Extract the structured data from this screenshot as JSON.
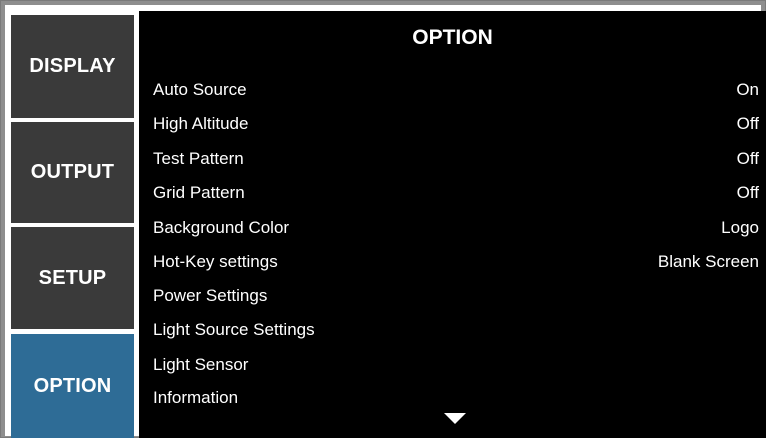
{
  "tabs": [
    {
      "label": "DISPLAY",
      "active": false
    },
    {
      "label": "OUTPUT",
      "active": false
    },
    {
      "label": "SETUP",
      "active": false
    },
    {
      "label": "OPTION",
      "active": true
    }
  ],
  "panel": {
    "title": "OPTION",
    "items": [
      {
        "label": "Auto Source",
        "value": "On"
      },
      {
        "label": "High Altitude",
        "value": "Off"
      },
      {
        "label": "Test Pattern",
        "value": "Off"
      },
      {
        "label": "Grid Pattern",
        "value": "Off"
      },
      {
        "label": "Background Color",
        "value": "Logo"
      },
      {
        "label": "Hot-Key settings",
        "value": "Blank Screen"
      },
      {
        "label": "Power Settings",
        "value": ""
      },
      {
        "label": "Light Source Settings",
        "value": ""
      },
      {
        "label": "Light Sensor",
        "value": ""
      },
      {
        "label": "Information",
        "value": ""
      }
    ],
    "scroll_icon": "chevron-down-icon"
  },
  "colors": {
    "tab_bg": "#3a3a3a",
    "tab_active_bg": "#2e6c96",
    "panel_bg": "#000000",
    "text": "#ffffff",
    "frame": "#8e8e8e"
  }
}
